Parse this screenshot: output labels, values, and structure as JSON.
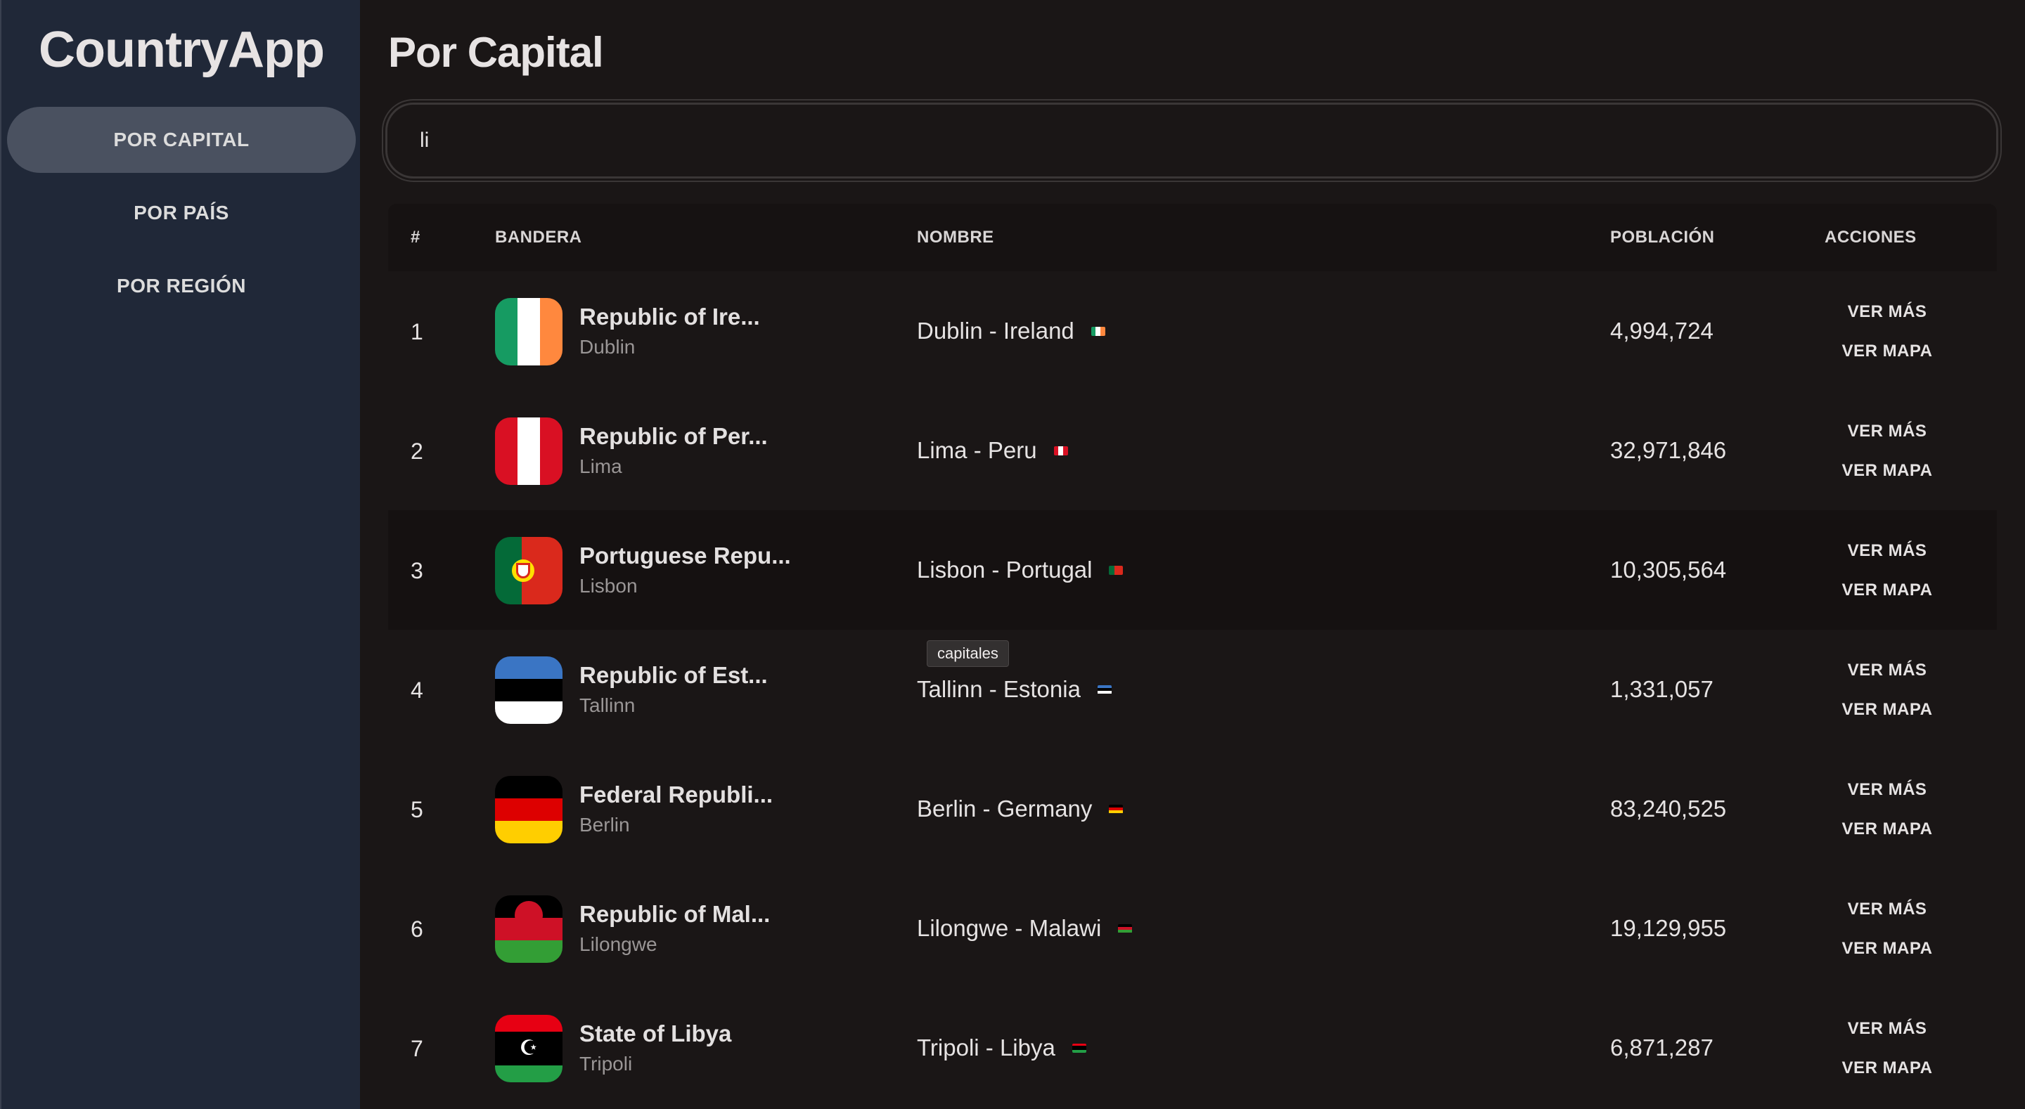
{
  "app": {
    "title": "CountryApp"
  },
  "sidebar": {
    "items": [
      {
        "label": "POR CAPITAL",
        "active": true
      },
      {
        "label": "POR PAÍS",
        "active": false
      },
      {
        "label": "POR REGIÓN",
        "active": false
      }
    ]
  },
  "main": {
    "title": "Por Capital",
    "search": {
      "value": "li"
    }
  },
  "table": {
    "headers": {
      "num": "#",
      "flag": "BANDERA",
      "name": "NOMBRE",
      "population": "POBLACIÓN",
      "actions": "ACCIONES"
    },
    "rows": [
      {
        "num": "1",
        "official": "Republic of Ire...",
        "capital": "Dublin",
        "capital_country": "Dublin - Ireland",
        "population": "4,994,724",
        "more": "VER MÁS",
        "map": "VER MAPA"
      },
      {
        "num": "2",
        "official": "Republic of Per...",
        "capital": "Lima",
        "capital_country": "Lima - Peru",
        "population": "32,971,846",
        "more": "VER MÁS",
        "map": "VER MAPA"
      },
      {
        "num": "3",
        "official": "Portuguese Repu...",
        "capital": "Lisbon",
        "capital_country": "Lisbon - Portugal",
        "population": "10,305,564",
        "more": "VER MÁS",
        "map": "VER MAPA"
      },
      {
        "num": "4",
        "official": "Republic of Est...",
        "capital": "Tallinn",
        "capital_country": "Tallinn - Estonia",
        "population": "1,331,057",
        "more": "VER MÁS",
        "map": "VER MAPA"
      },
      {
        "num": "5",
        "official": "Federal Republi...",
        "capital": "Berlin",
        "capital_country": "Berlin - Germany",
        "population": "83,240,525",
        "more": "VER MÁS",
        "map": "VER MAPA"
      },
      {
        "num": "6",
        "official": "Republic of Mal...",
        "capital": "Lilongwe",
        "capital_country": "Lilongwe - Malawi",
        "population": "19,129,955",
        "more": "VER MÁS",
        "map": "VER MAPA"
      },
      {
        "num": "7",
        "official": "State of Libya",
        "capital": "Tripoli",
        "capital_country": "Tripoli - Libya",
        "population": "6,871,287",
        "more": "VER MÁS",
        "map": "VER MAPA"
      }
    ]
  },
  "tooltip": {
    "text": "capitales"
  },
  "colors": {
    "sidebar_bg": "#202838",
    "main_bg": "#1a1616",
    "active_nav": "#4a5160"
  },
  "icons": [
    "flag-ireland-icon",
    "flag-peru-icon",
    "flag-portugal-icon",
    "flag-estonia-icon",
    "flag-germany-icon",
    "flag-malawi-icon",
    "flag-libya-icon"
  ]
}
